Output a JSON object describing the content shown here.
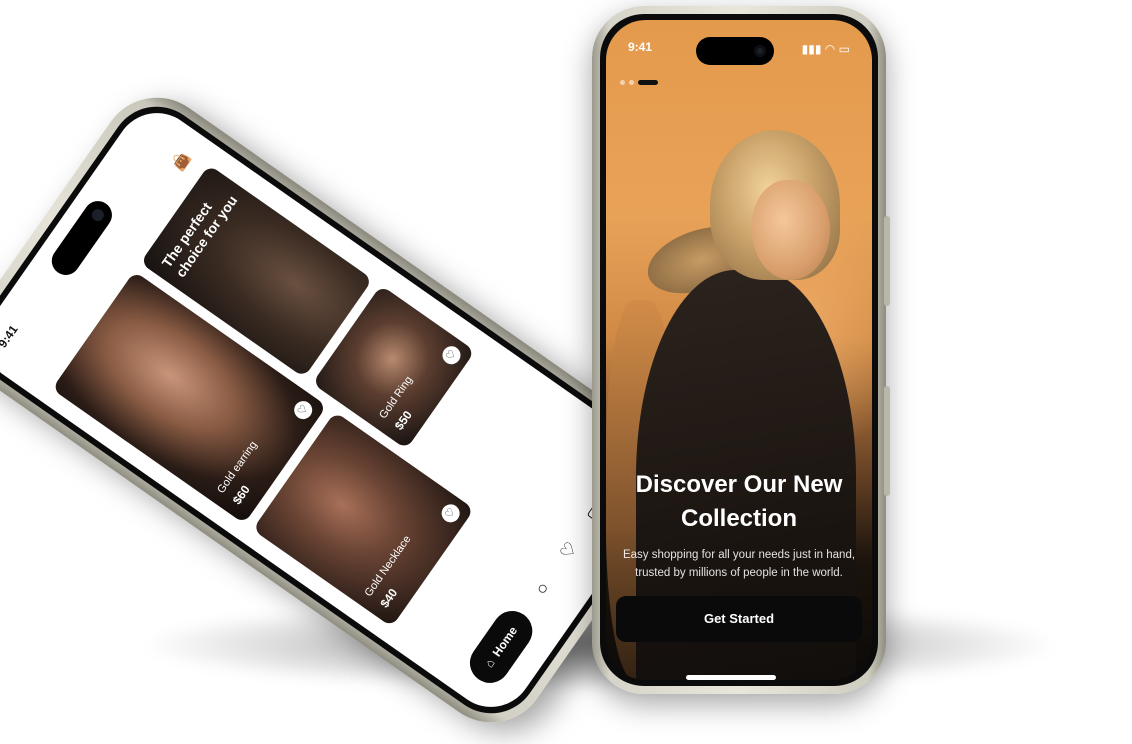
{
  "right_phone": {
    "status_time": "9:41",
    "onboarding_title": "Discover Our New Collection",
    "onboarding_subtitle": "Easy shopping for all your needs just in hand, trusted by millions of people in the world.",
    "cta_label": "Get Started"
  },
  "left_phone": {
    "status_time": "9:41",
    "featured_headline": "The perfect choice for you",
    "products": [
      {
        "name": "Gold earring",
        "price": "$60"
      },
      {
        "name": "Gold Ring",
        "price": "$50"
      },
      {
        "name": "Gold Necklace",
        "price": "$40"
      }
    ],
    "nav": {
      "home_label": "Home",
      "icons": [
        "home-icon",
        "search-icon",
        "heart-icon",
        "bag-icon",
        "profile-icon"
      ]
    }
  },
  "colors": {
    "hero_orange": "#e49a4c",
    "cta_black": "#0a0a0a",
    "frame_titanium": "#e6e4d9"
  }
}
